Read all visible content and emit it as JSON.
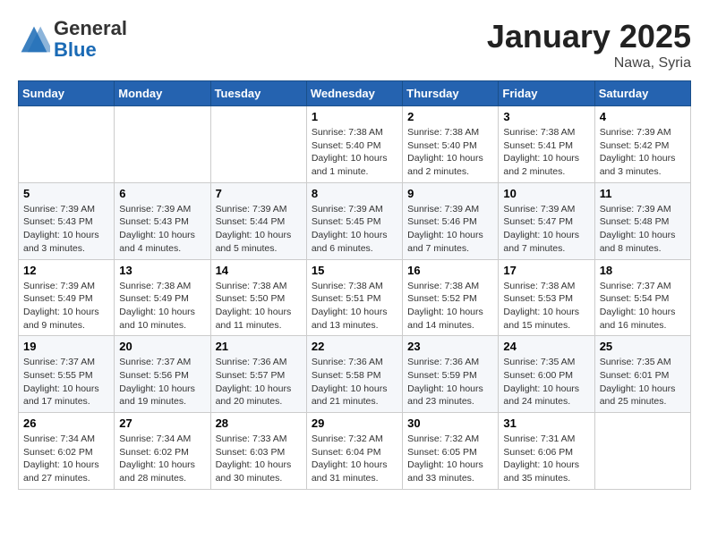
{
  "header": {
    "logo_general": "General",
    "logo_blue": "Blue",
    "month_title": "January 2025",
    "location": "Nawa, Syria"
  },
  "weekdays": [
    "Sunday",
    "Monday",
    "Tuesday",
    "Wednesday",
    "Thursday",
    "Friday",
    "Saturday"
  ],
  "weeks": [
    [
      {
        "day": "",
        "info": ""
      },
      {
        "day": "",
        "info": ""
      },
      {
        "day": "",
        "info": ""
      },
      {
        "day": "1",
        "info": "Sunrise: 7:38 AM\nSunset: 5:40 PM\nDaylight: 10 hours and 1 minute."
      },
      {
        "day": "2",
        "info": "Sunrise: 7:38 AM\nSunset: 5:40 PM\nDaylight: 10 hours and 2 minutes."
      },
      {
        "day": "3",
        "info": "Sunrise: 7:38 AM\nSunset: 5:41 PM\nDaylight: 10 hours and 2 minutes."
      },
      {
        "day": "4",
        "info": "Sunrise: 7:39 AM\nSunset: 5:42 PM\nDaylight: 10 hours and 3 minutes."
      }
    ],
    [
      {
        "day": "5",
        "info": "Sunrise: 7:39 AM\nSunset: 5:43 PM\nDaylight: 10 hours and 3 minutes."
      },
      {
        "day": "6",
        "info": "Sunrise: 7:39 AM\nSunset: 5:43 PM\nDaylight: 10 hours and 4 minutes."
      },
      {
        "day": "7",
        "info": "Sunrise: 7:39 AM\nSunset: 5:44 PM\nDaylight: 10 hours and 5 minutes."
      },
      {
        "day": "8",
        "info": "Sunrise: 7:39 AM\nSunset: 5:45 PM\nDaylight: 10 hours and 6 minutes."
      },
      {
        "day": "9",
        "info": "Sunrise: 7:39 AM\nSunset: 5:46 PM\nDaylight: 10 hours and 7 minutes."
      },
      {
        "day": "10",
        "info": "Sunrise: 7:39 AM\nSunset: 5:47 PM\nDaylight: 10 hours and 7 minutes."
      },
      {
        "day": "11",
        "info": "Sunrise: 7:39 AM\nSunset: 5:48 PM\nDaylight: 10 hours and 8 minutes."
      }
    ],
    [
      {
        "day": "12",
        "info": "Sunrise: 7:39 AM\nSunset: 5:49 PM\nDaylight: 10 hours and 9 minutes."
      },
      {
        "day": "13",
        "info": "Sunrise: 7:38 AM\nSunset: 5:49 PM\nDaylight: 10 hours and 10 minutes."
      },
      {
        "day": "14",
        "info": "Sunrise: 7:38 AM\nSunset: 5:50 PM\nDaylight: 10 hours and 11 minutes."
      },
      {
        "day": "15",
        "info": "Sunrise: 7:38 AM\nSunset: 5:51 PM\nDaylight: 10 hours and 13 minutes."
      },
      {
        "day": "16",
        "info": "Sunrise: 7:38 AM\nSunset: 5:52 PM\nDaylight: 10 hours and 14 minutes."
      },
      {
        "day": "17",
        "info": "Sunrise: 7:38 AM\nSunset: 5:53 PM\nDaylight: 10 hours and 15 minutes."
      },
      {
        "day": "18",
        "info": "Sunrise: 7:37 AM\nSunset: 5:54 PM\nDaylight: 10 hours and 16 minutes."
      }
    ],
    [
      {
        "day": "19",
        "info": "Sunrise: 7:37 AM\nSunset: 5:55 PM\nDaylight: 10 hours and 17 minutes."
      },
      {
        "day": "20",
        "info": "Sunrise: 7:37 AM\nSunset: 5:56 PM\nDaylight: 10 hours and 19 minutes."
      },
      {
        "day": "21",
        "info": "Sunrise: 7:36 AM\nSunset: 5:57 PM\nDaylight: 10 hours and 20 minutes."
      },
      {
        "day": "22",
        "info": "Sunrise: 7:36 AM\nSunset: 5:58 PM\nDaylight: 10 hours and 21 minutes."
      },
      {
        "day": "23",
        "info": "Sunrise: 7:36 AM\nSunset: 5:59 PM\nDaylight: 10 hours and 23 minutes."
      },
      {
        "day": "24",
        "info": "Sunrise: 7:35 AM\nSunset: 6:00 PM\nDaylight: 10 hours and 24 minutes."
      },
      {
        "day": "25",
        "info": "Sunrise: 7:35 AM\nSunset: 6:01 PM\nDaylight: 10 hours and 25 minutes."
      }
    ],
    [
      {
        "day": "26",
        "info": "Sunrise: 7:34 AM\nSunset: 6:02 PM\nDaylight: 10 hours and 27 minutes."
      },
      {
        "day": "27",
        "info": "Sunrise: 7:34 AM\nSunset: 6:02 PM\nDaylight: 10 hours and 28 minutes."
      },
      {
        "day": "28",
        "info": "Sunrise: 7:33 AM\nSunset: 6:03 PM\nDaylight: 10 hours and 30 minutes."
      },
      {
        "day": "29",
        "info": "Sunrise: 7:32 AM\nSunset: 6:04 PM\nDaylight: 10 hours and 31 minutes."
      },
      {
        "day": "30",
        "info": "Sunrise: 7:32 AM\nSunset: 6:05 PM\nDaylight: 10 hours and 33 minutes."
      },
      {
        "day": "31",
        "info": "Sunrise: 7:31 AM\nSunset: 6:06 PM\nDaylight: 10 hours and 35 minutes."
      },
      {
        "day": "",
        "info": ""
      }
    ]
  ]
}
